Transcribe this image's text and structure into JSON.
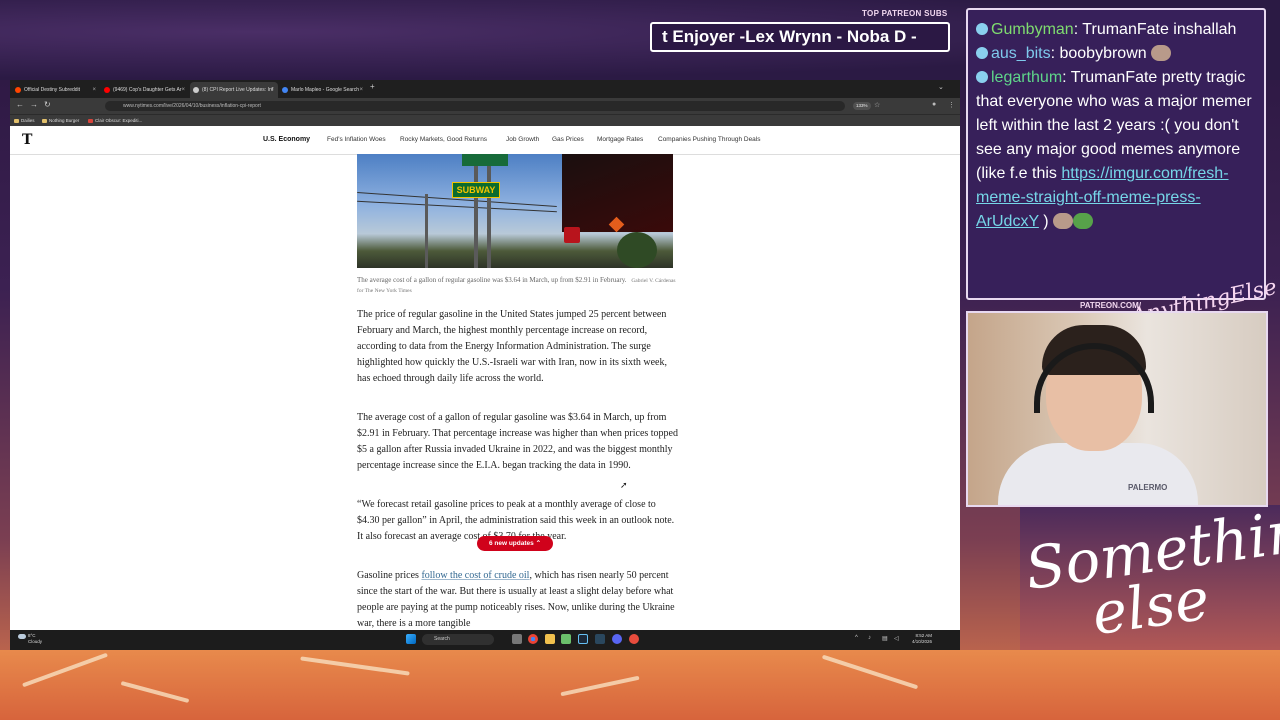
{
  "stream": {
    "subs_label": "TOP PATREON SUBS",
    "subs_ticker": "t Enjoyer -Lex Wrynn -  Noba D -",
    "patreon_label": "PATREON.COM/",
    "brand_small": "AnythingElse",
    "brand_big_line1": "Something",
    "brand_big_line2": "else",
    "webcam_shirt_text": "PALERMO"
  },
  "chat": {
    "messages": [
      {
        "user": "Gumbyman",
        "text": ": TrumanFate inshallah"
      },
      {
        "user": "aus_bits",
        "text": ": boobybrown",
        "emote": "face-emote"
      },
      {
        "user": "legarthum",
        "text": ": TrumanFate pretty tragic that everyone who was a major memer left within the last 2 years :( you don't see any major good memes anymore (like f.e this ",
        "link": "https://imgur.com/fresh-meme-straight-off-meme-press-ArUdcxY",
        "tail": " )"
      }
    ]
  },
  "browser": {
    "tabs": [
      {
        "label": "Official Destiny Subreddit",
        "favicon_color": "#ff4500"
      },
      {
        "label": "(9469) Cop's Daughter Gets Ar",
        "favicon_color": "#ff0000"
      },
      {
        "label": "(8) CPI Report Live Updates: Inf",
        "favicon_color": "#cccccc",
        "active": true
      },
      {
        "label": "Marlo Mapleo - Google Search",
        "favicon_color": "#4285f4"
      }
    ],
    "url": "www.nytimes.com/live/2026/04/10/business/inflation-cpi-report",
    "zoom": "133%",
    "bookmarks": [
      {
        "label": "Dailies"
      },
      {
        "label": "Nothing Burger"
      },
      {
        "label": "Clair Obscur: Expediti..."
      }
    ]
  },
  "nyt": {
    "logo": "T",
    "primary_nav": "U.S. Economy",
    "nav_links": [
      "Fed's Inflation Woes",
      "Rocky Markets, Good Returns",
      "Job Growth",
      "Gas Prices",
      "Mortgage Rates",
      "Companies Pushing Through Deals"
    ],
    "photo_sign": "SUBWAY",
    "caption": "The average cost of a gallon of regular gasoline was $3.64 in March, up from $2.91 in February.",
    "credit": "Gabriel V. Cárdenas for The New York Times",
    "para1": "The price of regular gasoline in the United States jumped 25 percent between February and March, the highest monthly percentage increase on record, according to data from the Energy Information Administration. The surge highlighted how quickly the U.S.-Israeli war with Iran, now in its sixth week, has echoed through daily life across the world.",
    "para2": "The average cost of a gallon of regular gasoline was $3.64 in March, up from $2.91 in February. That percentage increase was higher than when prices topped $5 a gallon after Russia invaded Ukraine in 2022, and was the biggest monthly percentage increase since the E.I.A. began tracking the data in 1990.",
    "para3": "“We forecast retail gasoline prices to peak at a monthly average of close to $4.30 per gallon” in April, the administration said this week in an outlook note. It also forecast an average cost of $3.70 for the year.",
    "para4_pre": "Gasoline prices ",
    "para4_link": "follow the cost of crude oil",
    "para4_post": ", which has risen nearly 50 percent since the start of the war. But there is usually at least a slight delay before what people are paying at the pump noticeably rises. Now, unlike during the Ukraine war, there is a more tangible",
    "updates_pill": "6 new updates"
  },
  "taskbar": {
    "weather_temp": "8°C",
    "weather_desc": "Cloudy",
    "search_placeholder": "Search",
    "time": "8:52 AM",
    "date": "4/10/2026"
  }
}
